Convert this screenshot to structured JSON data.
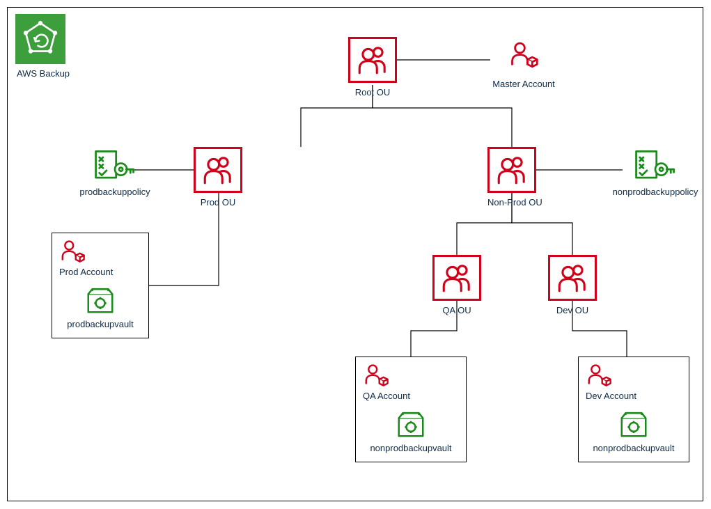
{
  "awsService": {
    "label": "AWS Backup"
  },
  "rootOU": {
    "label": "Root OU"
  },
  "masterAccount": {
    "label": "Master Account"
  },
  "prodOU": {
    "label": "Prod OU"
  },
  "nonProdOU": {
    "label": "Non-Prod OU"
  },
  "qaOU": {
    "label": "QA OU"
  },
  "devOU": {
    "label": "Dev OU"
  },
  "prodPolicy": {
    "label": "prodbackuppolicy"
  },
  "nonProdPolicy": {
    "label": "nonprodbackuppolicy"
  },
  "prodAccount": {
    "name": "Prod Account",
    "vault": "prodbackupvault"
  },
  "qaAccount": {
    "name": "QA Account",
    "vault": "nonprodbackupvault"
  },
  "devAccount": {
    "name": "Dev Account",
    "vault": "nonprodbackupvault"
  },
  "colors": {
    "red": "#d0021b",
    "green": "#1a8a1a",
    "text": "#0f2b46"
  }
}
